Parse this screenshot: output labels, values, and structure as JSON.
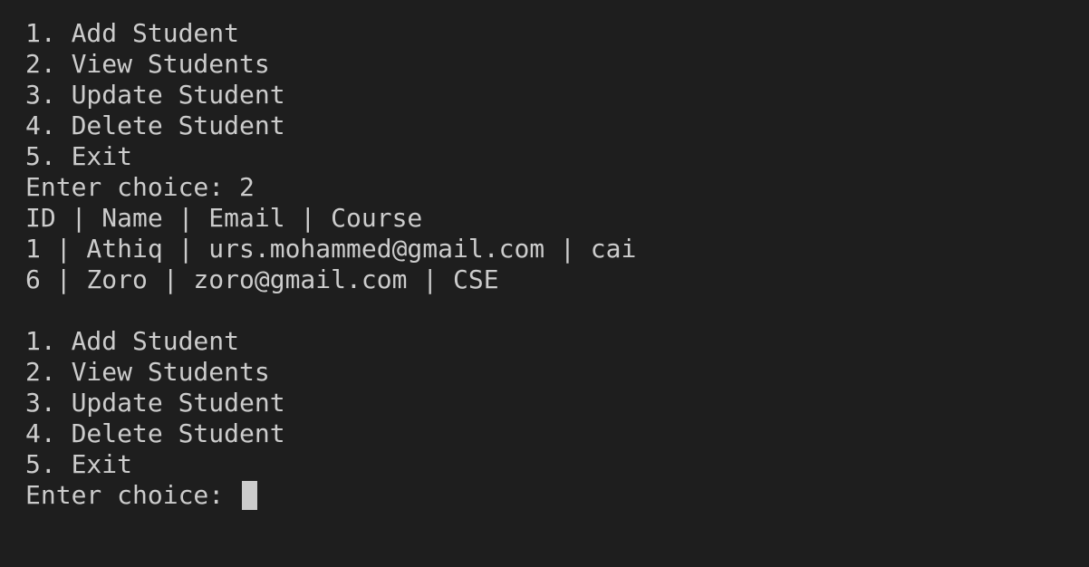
{
  "terminal": {
    "colors": {
      "background": "#1e1e1e",
      "foreground": "#cccccc",
      "cursor": "#cccccc"
    },
    "lines": [
      "1. Add Student",
      "2. View Students",
      "3. Update Student",
      "4. Delete Student",
      "5. Exit",
      "Enter choice: 2",
      "ID | Name | Email | Course",
      "1 | Athiq | urs.mohammed@gmail.com | cai",
      "6 | Zoro | zoro@gmail.com | CSE",
      "",
      "1. Add Student",
      "2. View Students",
      "3. Update Student",
      "4. Delete Student",
      "5. Exit"
    ],
    "prompt": "Enter choice: "
  }
}
